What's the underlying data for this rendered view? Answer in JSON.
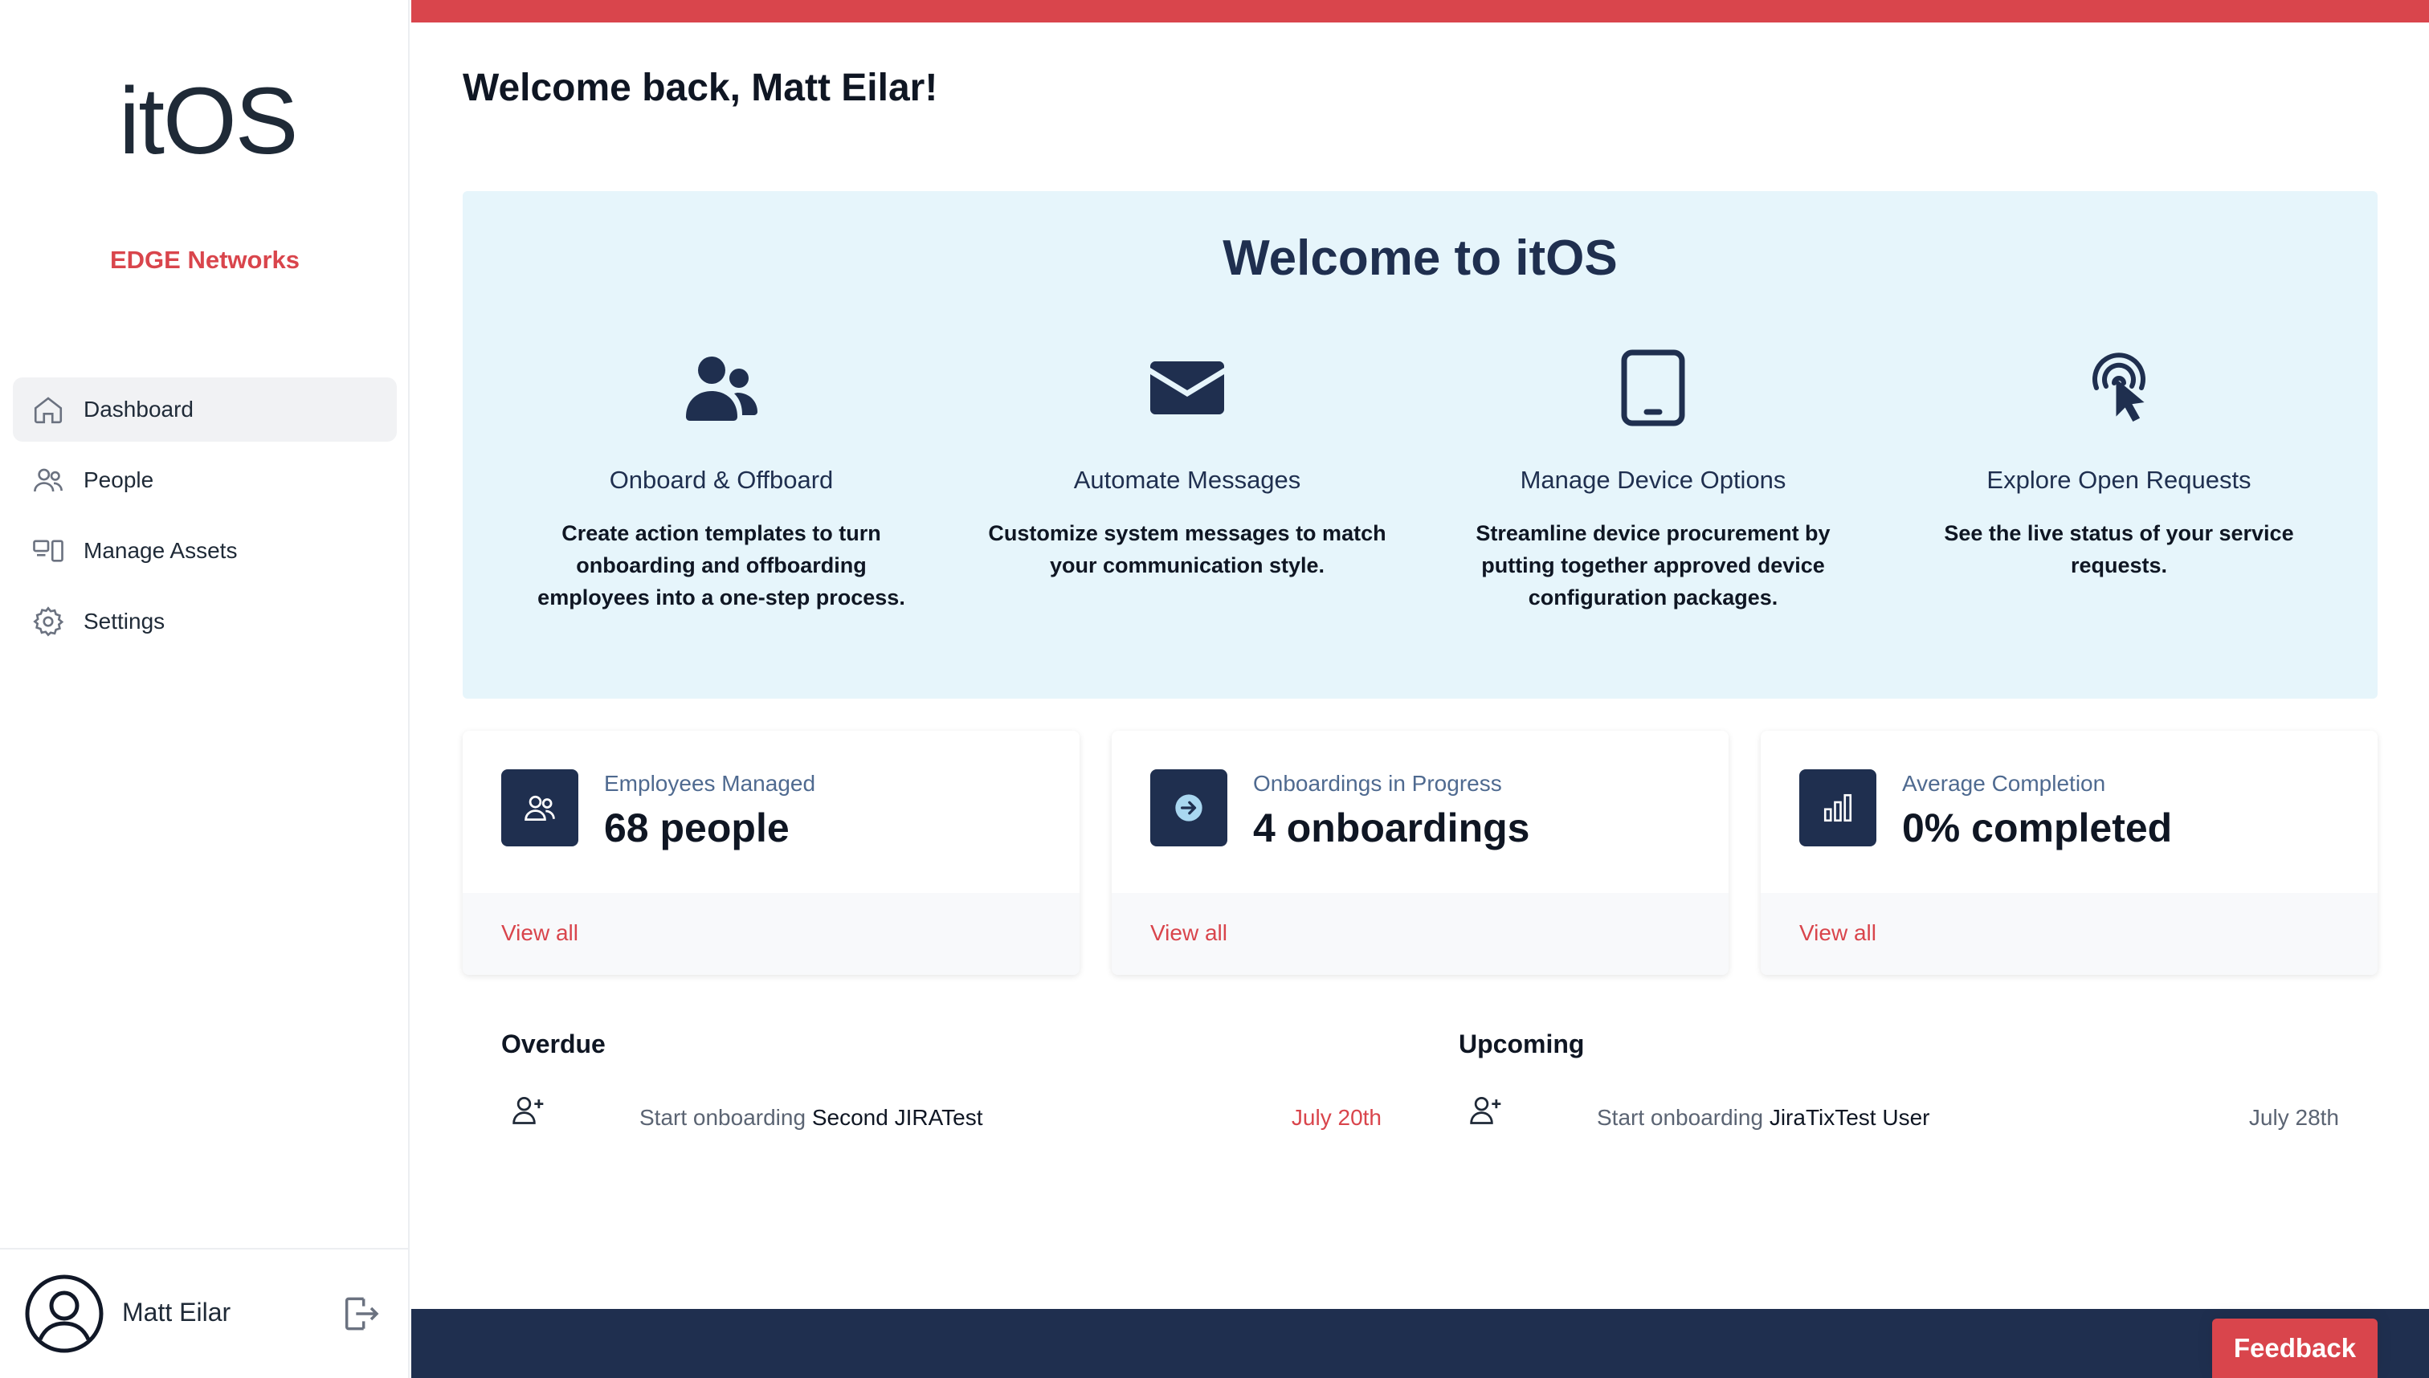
{
  "colors": {
    "accent": "#d9454c",
    "navy": "#1f2f4f",
    "hero_bg": "#e6f5fb"
  },
  "sidebar": {
    "logo_text": "itOS",
    "logo_i": "ı",
    "logo_rest": "tOS",
    "org_name": "EDGE Networks",
    "items": [
      {
        "label": "Dashboard",
        "icon": "home-icon",
        "active": true
      },
      {
        "label": "People",
        "icon": "people-icon"
      },
      {
        "label": "Manage Assets",
        "icon": "assets-icon"
      },
      {
        "label": "Settings",
        "icon": "gear-icon"
      }
    ],
    "user_name": "Matt Eilar"
  },
  "main": {
    "greeting": "Welcome back, Matt Eilar!",
    "hero": {
      "title": "Welcome to itOS",
      "features": [
        {
          "name": "Onboard & Offboard",
          "icon": "users-icon",
          "desc": "Create action templates to turn onboarding and offboarding employees into a one-step process."
        },
        {
          "name": "Automate Messages",
          "icon": "envelope-icon",
          "desc": "Customize system messages to match your communication style."
        },
        {
          "name": "Manage Device Options",
          "icon": "tablet-icon",
          "desc": "Streamline device procurement by putting together approved device configuration packages."
        },
        {
          "name": "Explore Open Requests",
          "icon": "pointer-click-icon",
          "desc": "See the live status of your service requests."
        }
      ]
    },
    "stats": [
      {
        "label": "Employees Managed",
        "value": "68 people",
        "link": "View all",
        "icon": "users-icon"
      },
      {
        "label": "Onboardings in Progress",
        "value": "4 onboardings",
        "link": "View all",
        "icon": "arrow-circle-icon"
      },
      {
        "label": "Average Completion",
        "value": "0% completed",
        "link": "View all",
        "icon": "bar-chart-icon"
      }
    ],
    "overdue": {
      "title": "Overdue",
      "items": [
        {
          "action": "Start onboarding",
          "name": "Second JIRATest",
          "date": "July 20th",
          "date_color": "#d9454c"
        }
      ]
    },
    "upcoming": {
      "title": "Upcoming",
      "items": [
        {
          "action": "Start onboarding",
          "name": "JiraTixTest User",
          "date": "July 28th",
          "date_color": "#5b6473"
        }
      ]
    }
  },
  "feedback_label": "Feedback"
}
